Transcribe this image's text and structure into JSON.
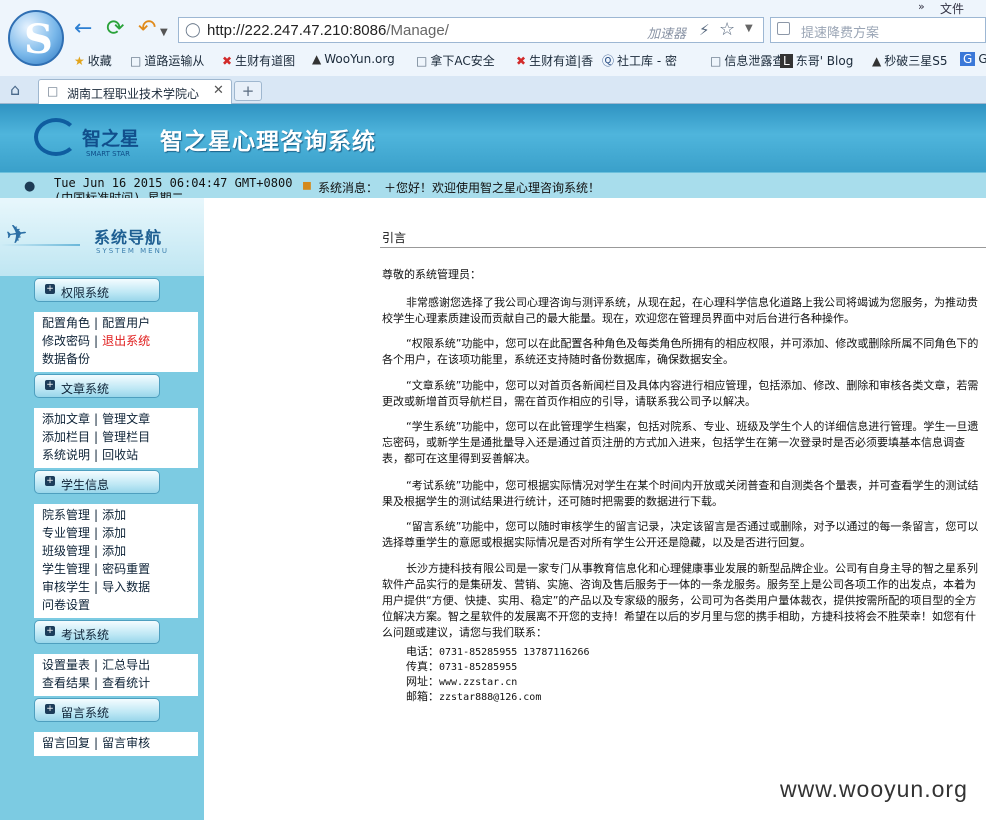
{
  "browser": {
    "url_host": "http://222.247.47.210:8086",
    "url_path": "/Manage/",
    "accelerator_label": "加速器",
    "search_placeholder": "提速降费方案",
    "menu_file": "文件",
    "bookmarks": [
      {
        "icon": "star-icon",
        "label": "收藏"
      },
      {
        "icon": "doc-icon",
        "label": "道路运输从"
      },
      {
        "icon": "money-icon",
        "label": "生财有道图"
      },
      {
        "icon": "wooyun-icon",
        "label": "WooYun.org"
      },
      {
        "icon": "doc-icon",
        "label": "拿下AC安全"
      },
      {
        "icon": "money-icon",
        "label": "生财有道|香"
      },
      {
        "icon": "q-icon",
        "label": "社工库 - 密"
      },
      {
        "icon": "doc-icon",
        "label": "信息泄露查"
      },
      {
        "icon": "l-icon",
        "label": "东哥' Blog"
      },
      {
        "icon": "wooyun-icon",
        "label": "秒破三星S5"
      },
      {
        "icon": "g-icon",
        "label": "G"
      }
    ],
    "tab_title": "湖南工程职业技术学院心"
  },
  "header": {
    "logo_text": "智之星",
    "logo_sub": "SMART STAR",
    "site_title": "智之星心理咨询系统"
  },
  "info_bar": {
    "datetime": "Tue Jun 16 2015 06:04:47 GMT+0800 (中国标准时间) 星期二",
    "msg_label": "系统消息：",
    "msg_text": "＋您好！欢迎使用智之星心理咨询系统！"
  },
  "sidebar": {
    "title": "系统导航",
    "title_sub": "SYSTEM MENU",
    "sections": [
      {
        "label": "权限系统",
        "lines": [
          [
            {
              "text": "配置角色"
            },
            {
              "text": "配置用户"
            }
          ],
          [
            {
              "text": "修改密码"
            },
            {
              "text": "退出系统",
              "red": true
            }
          ],
          [
            {
              "text": "数据备份"
            }
          ]
        ]
      },
      {
        "label": "文章系统",
        "lines": [
          [
            {
              "text": "添加文章"
            },
            {
              "text": "管理文章"
            }
          ],
          [
            {
              "text": "添加栏目"
            },
            {
              "text": "管理栏目"
            }
          ],
          [
            {
              "text": "系统说明"
            },
            {
              "text": "回收站"
            }
          ]
        ]
      },
      {
        "label": "学生信息",
        "lines": [
          [
            {
              "text": "院系管理"
            },
            {
              "text": "添加"
            }
          ],
          [
            {
              "text": "专业管理"
            },
            {
              "text": "添加"
            }
          ],
          [
            {
              "text": "班级管理"
            },
            {
              "text": "添加"
            }
          ],
          [
            {
              "text": "学生管理"
            },
            {
              "text": "密码重置"
            }
          ],
          [
            {
              "text": "审核学生"
            },
            {
              "text": "导入数据"
            }
          ],
          [
            {
              "text": "问卷设置"
            }
          ]
        ]
      },
      {
        "label": "考试系统",
        "lines": [
          [
            {
              "text": "设置量表"
            },
            {
              "text": "汇总导出"
            }
          ],
          [
            {
              "text": "查看结果"
            },
            {
              "text": "查看统计"
            }
          ]
        ]
      },
      {
        "label": "留言系统",
        "lines": [
          [
            {
              "text": "留言回复"
            },
            {
              "text": "留言审核"
            }
          ]
        ]
      }
    ]
  },
  "content": {
    "heading": "引言",
    "greeting": "尊敬的系统管理员：",
    "paragraphs": [
      "非常感谢您选择了我公司心理咨询与测评系统，从现在起，在心理科学信息化道路上我公司将竭诚为您服务，为推动贵校学生心理素质建设而贡献自己的最大能量。现在，欢迎您在管理员界面中对后台进行各种操作。",
      "“权限系统”功能中，您可以在此配置各种角色及每类角色所拥有的相应权限，并可添加、修改或删除所属不同角色下的各个用户，在该项功能里，系统还支持随时备份数据库，确保数据安全。",
      "“文章系统”功能中，您可以对首页各新闻栏目及具体内容进行相应管理，包括添加、修改、删除和审核各类文章，若需更改或新增首页导航栏目，需在首页作相应的引导，请联系我公司予以解决。",
      "“学生系统”功能中，您可以在此管理学生档案，包括对院系、专业、班级及学生个人的详细信息进行管理。学生一旦遗忘密码，或新学生是通批量导入还是通过首页注册的方式加入进来，包括学生在第一次登录时是否必须要填基本信息调查表，都可在这里得到妥善解决。",
      "“考试系统”功能中，您可根据实际情况对学生在某个时间内开放或关闭普查和自测类各个量表，并可查看学生的测试结果及根据学生的测试结果进行统计，还可随时把需要的数据进行下载。",
      "“留言系统”功能中，您可以随时审核学生的留言记录，决定该留言是否通过或删除，对予以通过的每一条留言，您可以选择尊重学生的意愿或根据实际情况是否对所有学生公开还是隐藏，以及是否进行回复。",
      "长沙方捷科技有限公司是一家专门从事教育信息化和心理健康事业发展的新型品牌企业。公司有自身主导的智之星系列软件产品实行的是集研发、营销、实施、咨询及售后服务于一体的一条龙服务。服务至上是公司各项工作的出发点，本着为用户提供“方便、快捷、实用、稳定”的产品以及专家级的服务，公司可为各类用户量体裁衣，提供按需所配的项目型的全方位解决方案。智之星软件的发展离不开您的支持！希望在以后的岁月里与您的携手相助，方捷科技将会不胜荣幸！如您有什么问题或建议，请您与我们联系："
    ],
    "contact": {
      "phone_label": "电话：",
      "phone": "0731-85285955 13787116266",
      "fax_label": "传真：",
      "fax": "0731-85285955",
      "site_label": "网址：",
      "site": "www.zzstar.cn",
      "email_label": "邮箱：",
      "email": "zzstar888@126.com"
    }
  },
  "watermark": "www.wooyun.org"
}
